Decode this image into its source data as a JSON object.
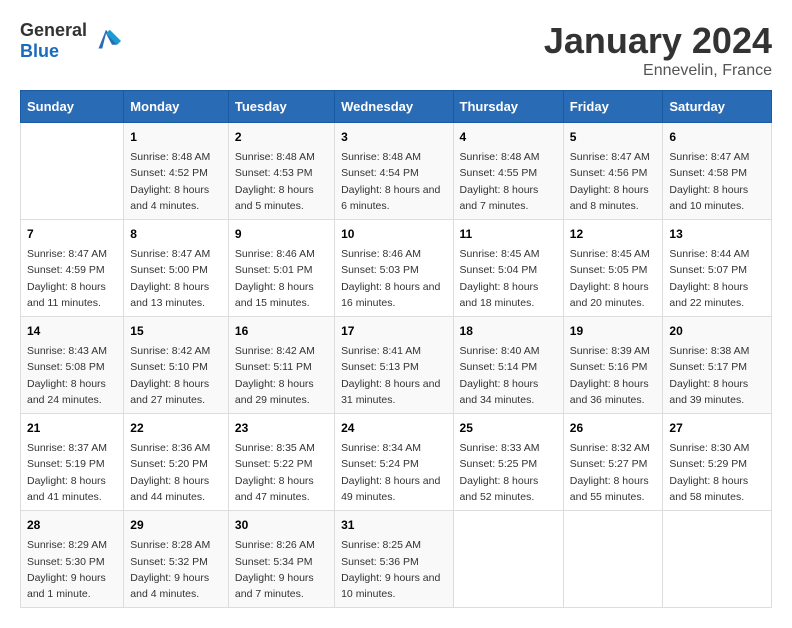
{
  "header": {
    "logo_general": "General",
    "logo_blue": "Blue",
    "month": "January 2024",
    "location": "Ennevelin, France"
  },
  "weekdays": [
    "Sunday",
    "Monday",
    "Tuesday",
    "Wednesday",
    "Thursday",
    "Friday",
    "Saturday"
  ],
  "weeks": [
    [
      {
        "day": "",
        "sunrise": "",
        "sunset": "",
        "daylight": ""
      },
      {
        "day": "1",
        "sunrise": "Sunrise: 8:48 AM",
        "sunset": "Sunset: 4:52 PM",
        "daylight": "Daylight: 8 hours and 4 minutes."
      },
      {
        "day": "2",
        "sunrise": "Sunrise: 8:48 AM",
        "sunset": "Sunset: 4:53 PM",
        "daylight": "Daylight: 8 hours and 5 minutes."
      },
      {
        "day": "3",
        "sunrise": "Sunrise: 8:48 AM",
        "sunset": "Sunset: 4:54 PM",
        "daylight": "Daylight: 8 hours and 6 minutes."
      },
      {
        "day": "4",
        "sunrise": "Sunrise: 8:48 AM",
        "sunset": "Sunset: 4:55 PM",
        "daylight": "Daylight: 8 hours and 7 minutes."
      },
      {
        "day": "5",
        "sunrise": "Sunrise: 8:47 AM",
        "sunset": "Sunset: 4:56 PM",
        "daylight": "Daylight: 8 hours and 8 minutes."
      },
      {
        "day": "6",
        "sunrise": "Sunrise: 8:47 AM",
        "sunset": "Sunset: 4:58 PM",
        "daylight": "Daylight: 8 hours and 10 minutes."
      }
    ],
    [
      {
        "day": "7",
        "sunrise": "Sunrise: 8:47 AM",
        "sunset": "Sunset: 4:59 PM",
        "daylight": "Daylight: 8 hours and 11 minutes."
      },
      {
        "day": "8",
        "sunrise": "Sunrise: 8:47 AM",
        "sunset": "Sunset: 5:00 PM",
        "daylight": "Daylight: 8 hours and 13 minutes."
      },
      {
        "day": "9",
        "sunrise": "Sunrise: 8:46 AM",
        "sunset": "Sunset: 5:01 PM",
        "daylight": "Daylight: 8 hours and 15 minutes."
      },
      {
        "day": "10",
        "sunrise": "Sunrise: 8:46 AM",
        "sunset": "Sunset: 5:03 PM",
        "daylight": "Daylight: 8 hours and 16 minutes."
      },
      {
        "day": "11",
        "sunrise": "Sunrise: 8:45 AM",
        "sunset": "Sunset: 5:04 PM",
        "daylight": "Daylight: 8 hours and 18 minutes."
      },
      {
        "day": "12",
        "sunrise": "Sunrise: 8:45 AM",
        "sunset": "Sunset: 5:05 PM",
        "daylight": "Daylight: 8 hours and 20 minutes."
      },
      {
        "day": "13",
        "sunrise": "Sunrise: 8:44 AM",
        "sunset": "Sunset: 5:07 PM",
        "daylight": "Daylight: 8 hours and 22 minutes."
      }
    ],
    [
      {
        "day": "14",
        "sunrise": "Sunrise: 8:43 AM",
        "sunset": "Sunset: 5:08 PM",
        "daylight": "Daylight: 8 hours and 24 minutes."
      },
      {
        "day": "15",
        "sunrise": "Sunrise: 8:42 AM",
        "sunset": "Sunset: 5:10 PM",
        "daylight": "Daylight: 8 hours and 27 minutes."
      },
      {
        "day": "16",
        "sunrise": "Sunrise: 8:42 AM",
        "sunset": "Sunset: 5:11 PM",
        "daylight": "Daylight: 8 hours and 29 minutes."
      },
      {
        "day": "17",
        "sunrise": "Sunrise: 8:41 AM",
        "sunset": "Sunset: 5:13 PM",
        "daylight": "Daylight: 8 hours and 31 minutes."
      },
      {
        "day": "18",
        "sunrise": "Sunrise: 8:40 AM",
        "sunset": "Sunset: 5:14 PM",
        "daylight": "Daylight: 8 hours and 34 minutes."
      },
      {
        "day": "19",
        "sunrise": "Sunrise: 8:39 AM",
        "sunset": "Sunset: 5:16 PM",
        "daylight": "Daylight: 8 hours and 36 minutes."
      },
      {
        "day": "20",
        "sunrise": "Sunrise: 8:38 AM",
        "sunset": "Sunset: 5:17 PM",
        "daylight": "Daylight: 8 hours and 39 minutes."
      }
    ],
    [
      {
        "day": "21",
        "sunrise": "Sunrise: 8:37 AM",
        "sunset": "Sunset: 5:19 PM",
        "daylight": "Daylight: 8 hours and 41 minutes."
      },
      {
        "day": "22",
        "sunrise": "Sunrise: 8:36 AM",
        "sunset": "Sunset: 5:20 PM",
        "daylight": "Daylight: 8 hours and 44 minutes."
      },
      {
        "day": "23",
        "sunrise": "Sunrise: 8:35 AM",
        "sunset": "Sunset: 5:22 PM",
        "daylight": "Daylight: 8 hours and 47 minutes."
      },
      {
        "day": "24",
        "sunrise": "Sunrise: 8:34 AM",
        "sunset": "Sunset: 5:24 PM",
        "daylight": "Daylight: 8 hours and 49 minutes."
      },
      {
        "day": "25",
        "sunrise": "Sunrise: 8:33 AM",
        "sunset": "Sunset: 5:25 PM",
        "daylight": "Daylight: 8 hours and 52 minutes."
      },
      {
        "day": "26",
        "sunrise": "Sunrise: 8:32 AM",
        "sunset": "Sunset: 5:27 PM",
        "daylight": "Daylight: 8 hours and 55 minutes."
      },
      {
        "day": "27",
        "sunrise": "Sunrise: 8:30 AM",
        "sunset": "Sunset: 5:29 PM",
        "daylight": "Daylight: 8 hours and 58 minutes."
      }
    ],
    [
      {
        "day": "28",
        "sunrise": "Sunrise: 8:29 AM",
        "sunset": "Sunset: 5:30 PM",
        "daylight": "Daylight: 9 hours and 1 minute."
      },
      {
        "day": "29",
        "sunrise": "Sunrise: 8:28 AM",
        "sunset": "Sunset: 5:32 PM",
        "daylight": "Daylight: 9 hours and 4 minutes."
      },
      {
        "day": "30",
        "sunrise": "Sunrise: 8:26 AM",
        "sunset": "Sunset: 5:34 PM",
        "daylight": "Daylight: 9 hours and 7 minutes."
      },
      {
        "day": "31",
        "sunrise": "Sunrise: 8:25 AM",
        "sunset": "Sunset: 5:36 PM",
        "daylight": "Daylight: 9 hours and 10 minutes."
      },
      {
        "day": "",
        "sunrise": "",
        "sunset": "",
        "daylight": ""
      },
      {
        "day": "",
        "sunrise": "",
        "sunset": "",
        "daylight": ""
      },
      {
        "day": "",
        "sunrise": "",
        "sunset": "",
        "daylight": ""
      }
    ]
  ]
}
